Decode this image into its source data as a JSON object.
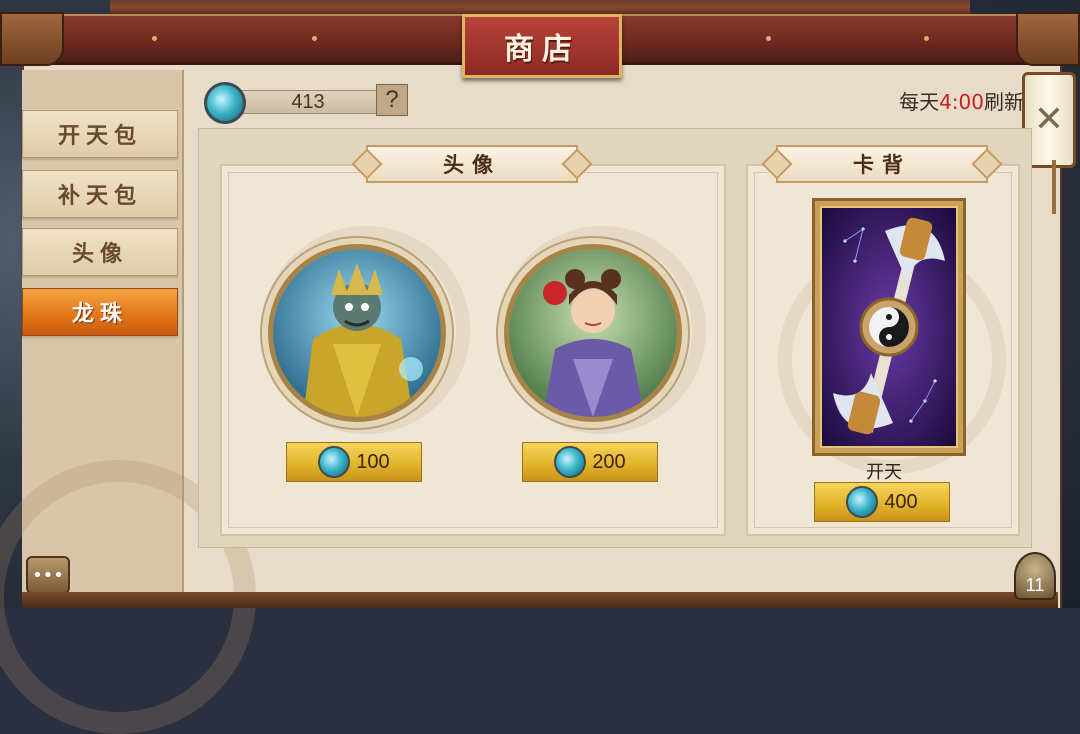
{
  "header": {
    "title": "商店"
  },
  "sidebar": {
    "tabs": [
      {
        "label": "开天包",
        "active": false
      },
      {
        "label": "补天包",
        "active": false
      },
      {
        "label": "头像",
        "active": false
      },
      {
        "label": "龙珠",
        "active": true
      }
    ],
    "chat_icon": "chat-bubble-icon"
  },
  "currency": {
    "amount": "413",
    "help_label": "?",
    "icon": "dragon-orb-icon"
  },
  "refresh": {
    "prefix": "每天",
    "time": "4:00",
    "suffix": "刷新"
  },
  "close_label": "✕",
  "sections": {
    "avatars": {
      "title": "头像",
      "items": [
        {
          "name": "demon-king-avatar",
          "price": "100"
        },
        {
          "name": "maiden-with-apple-avatar",
          "price": "200"
        }
      ]
    },
    "card_backs": {
      "title": "卡背",
      "items": [
        {
          "name": "开天",
          "price": "400"
        }
      ]
    }
  },
  "level": "11",
  "colors": {
    "accent_orange": "#e27418",
    "gold": "#e3b52c",
    "red_title": "#8c2a24",
    "refresh_time": "#c9221e"
  }
}
